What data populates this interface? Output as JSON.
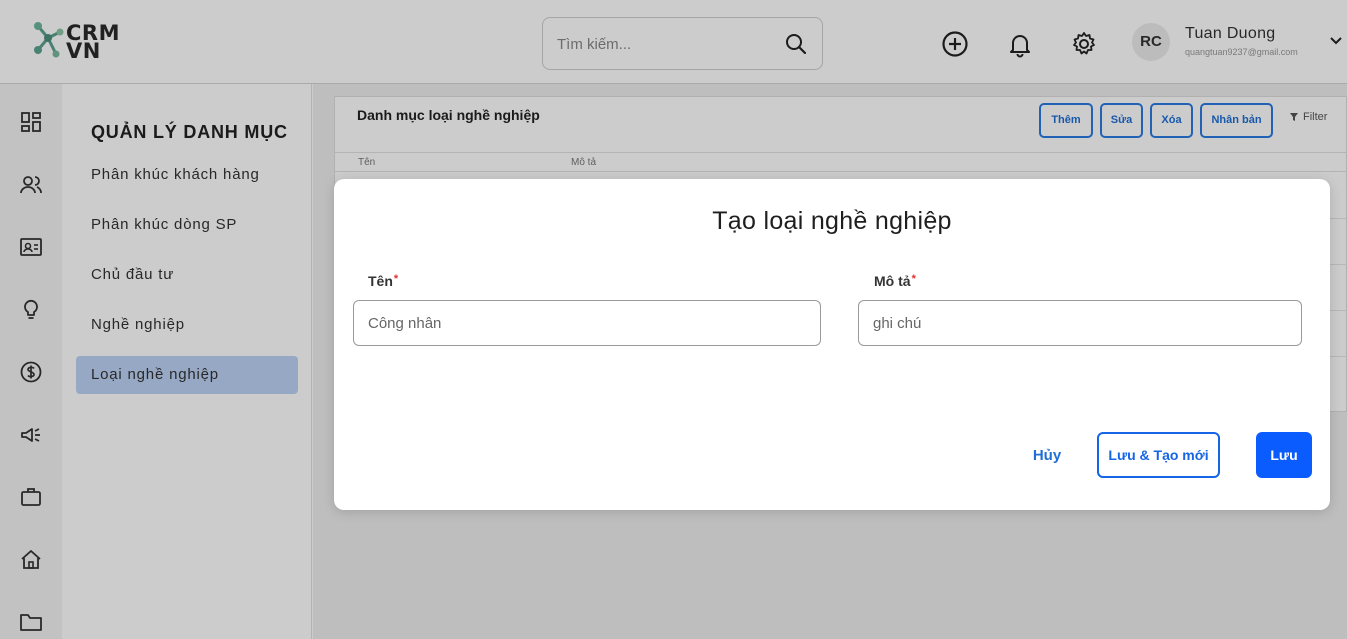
{
  "header": {
    "logo_line1": "CRM",
    "logo_line2": "VN",
    "search_placeholder": "Tìm kiếm...",
    "user_initials": "RC",
    "user_name": "Tuan Duong",
    "user_email": "quangtuan9237@gmail.com",
    "icons": [
      "add-circle-icon",
      "bell-icon",
      "gear-icon",
      "chevron-down-icon"
    ]
  },
  "rail": {
    "icons": [
      "dashboard-icon",
      "users-icon",
      "contact-card-icon",
      "lightbulb-icon",
      "dollar-icon",
      "megaphone-icon",
      "briefcase-icon",
      "home-icon",
      "folder-icon"
    ]
  },
  "category_menu": {
    "title": "QUẢN LÝ DANH MỤC",
    "items": [
      {
        "label": "Phân khúc khách hàng",
        "active": false
      },
      {
        "label": "Phân khúc dòng SP",
        "active": false
      },
      {
        "label": "Chủ đầu tư",
        "active": false
      },
      {
        "label": "Nghề nghiệp",
        "active": false
      },
      {
        "label": "Loại nghề nghiệp",
        "active": true
      }
    ]
  },
  "content": {
    "title": "Danh mục loại nghề nghiệp",
    "toolbar": {
      "add": "Thêm",
      "edit": "Sửa",
      "delete": "Xóa",
      "duplicate": "Nhân bản",
      "filter": "Filter"
    },
    "table": {
      "columns": [
        "Tên",
        "Mô tả"
      ]
    }
  },
  "modal": {
    "title": "Tạo loại nghề nghiệp",
    "fields": {
      "name": {
        "label": "Tên",
        "required_mark": "*",
        "value": "Công nhân"
      },
      "description": {
        "label": "Mô tả",
        "required_mark": "*",
        "value": "ghi chú"
      }
    },
    "buttons": {
      "cancel": "Hủy",
      "save_and_new": "Lưu & Tạo mới",
      "save": "Lưu"
    }
  },
  "colors": {
    "accent": "#0a5cff",
    "active_menu": "#bcd3f5",
    "required": "#e03030"
  }
}
